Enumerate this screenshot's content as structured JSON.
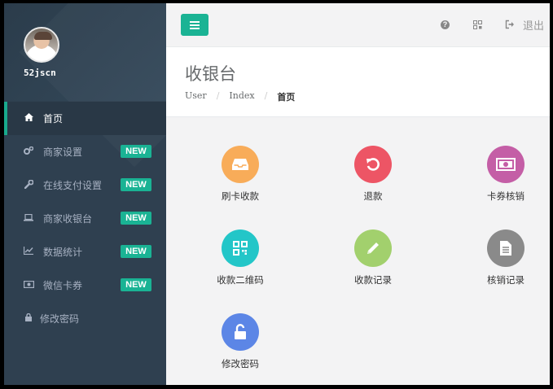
{
  "profile": {
    "username": "52jscn"
  },
  "nav": [
    {
      "label": "首页",
      "icon": "home-icon",
      "glyph": "⌂",
      "badge": ""
    },
    {
      "label": "商家设置",
      "icon": "gears-icon",
      "glyph": "⚙",
      "badge": "NEW"
    },
    {
      "label": "在线支付设置",
      "icon": "wrench-icon",
      "glyph": "✎",
      "badge": "NEW"
    },
    {
      "label": "商家收银台",
      "icon": "laptop-icon",
      "glyph": "▭",
      "badge": "NEW"
    },
    {
      "label": "数据统计",
      "icon": "line-chart-icon",
      "glyph": "↗",
      "badge": "NEW"
    },
    {
      "label": "微信卡券",
      "icon": "money-icon",
      "glyph": "▣",
      "badge": "NEW"
    },
    {
      "label": "修改密码",
      "icon": "lock-icon",
      "glyph": "🔒",
      "badge": ""
    }
  ],
  "topbar": {
    "logout_label": "退出"
  },
  "heading": {
    "title": "收银台",
    "breadcrumb": [
      "User",
      "Index",
      "首页"
    ]
  },
  "tiles": [
    {
      "label": "刷卡收款",
      "color": "#f8ac59",
      "icon": "inbox-icon"
    },
    {
      "label": "退款",
      "color": "#ed5565",
      "icon": "undo-icon"
    },
    {
      "label": "卡券核销",
      "color": "#c45ea6",
      "icon": "money-icon"
    },
    {
      "label": "收款二维码",
      "color": "#23c6c8",
      "icon": "qrcode-icon"
    },
    {
      "label": "收款记录",
      "color": "#a2d06d",
      "icon": "pencil-icon"
    },
    {
      "label": "核销记录",
      "color": "#8a8a8a",
      "icon": "file-text-icon"
    },
    {
      "label": "修改密码",
      "color": "#5c86e6",
      "icon": "unlock-icon"
    }
  ],
  "colors": {
    "sidebar": "#2f4050",
    "accent": "#1ab394"
  }
}
